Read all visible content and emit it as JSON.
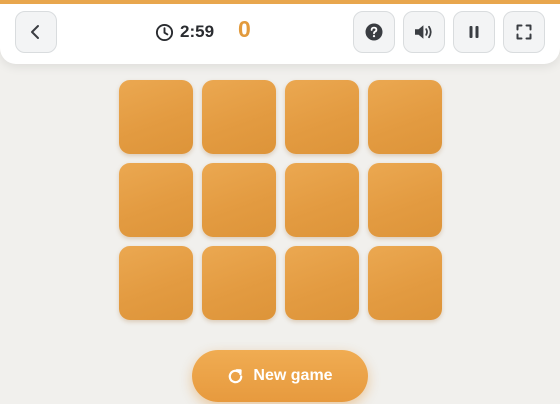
{
  "header": {
    "back_icon": "chevron-left-icon",
    "timer_icon": "clock-icon",
    "timer": "2:59",
    "score": "0",
    "buttons": {
      "help_icon": "question-circle-icon",
      "sound_icon": "speaker-volume-icon",
      "pause_icon": "pause-icon",
      "fullscreen_icon": "fullscreen-icon"
    }
  },
  "board": {
    "rows": 3,
    "columns": 4,
    "cards": [
      {
        "face": "down"
      },
      {
        "face": "down"
      },
      {
        "face": "down"
      },
      {
        "face": "down"
      },
      {
        "face": "down"
      },
      {
        "face": "down"
      },
      {
        "face": "down"
      },
      {
        "face": "down"
      },
      {
        "face": "down"
      },
      {
        "face": "down"
      },
      {
        "face": "down"
      },
      {
        "face": "down"
      }
    ]
  },
  "new_game": {
    "icon": "restart-icon",
    "label": "New game"
  },
  "colors": {
    "accent": "#e29a3c",
    "card": "#e39b41",
    "background": "#f1f0ed"
  }
}
